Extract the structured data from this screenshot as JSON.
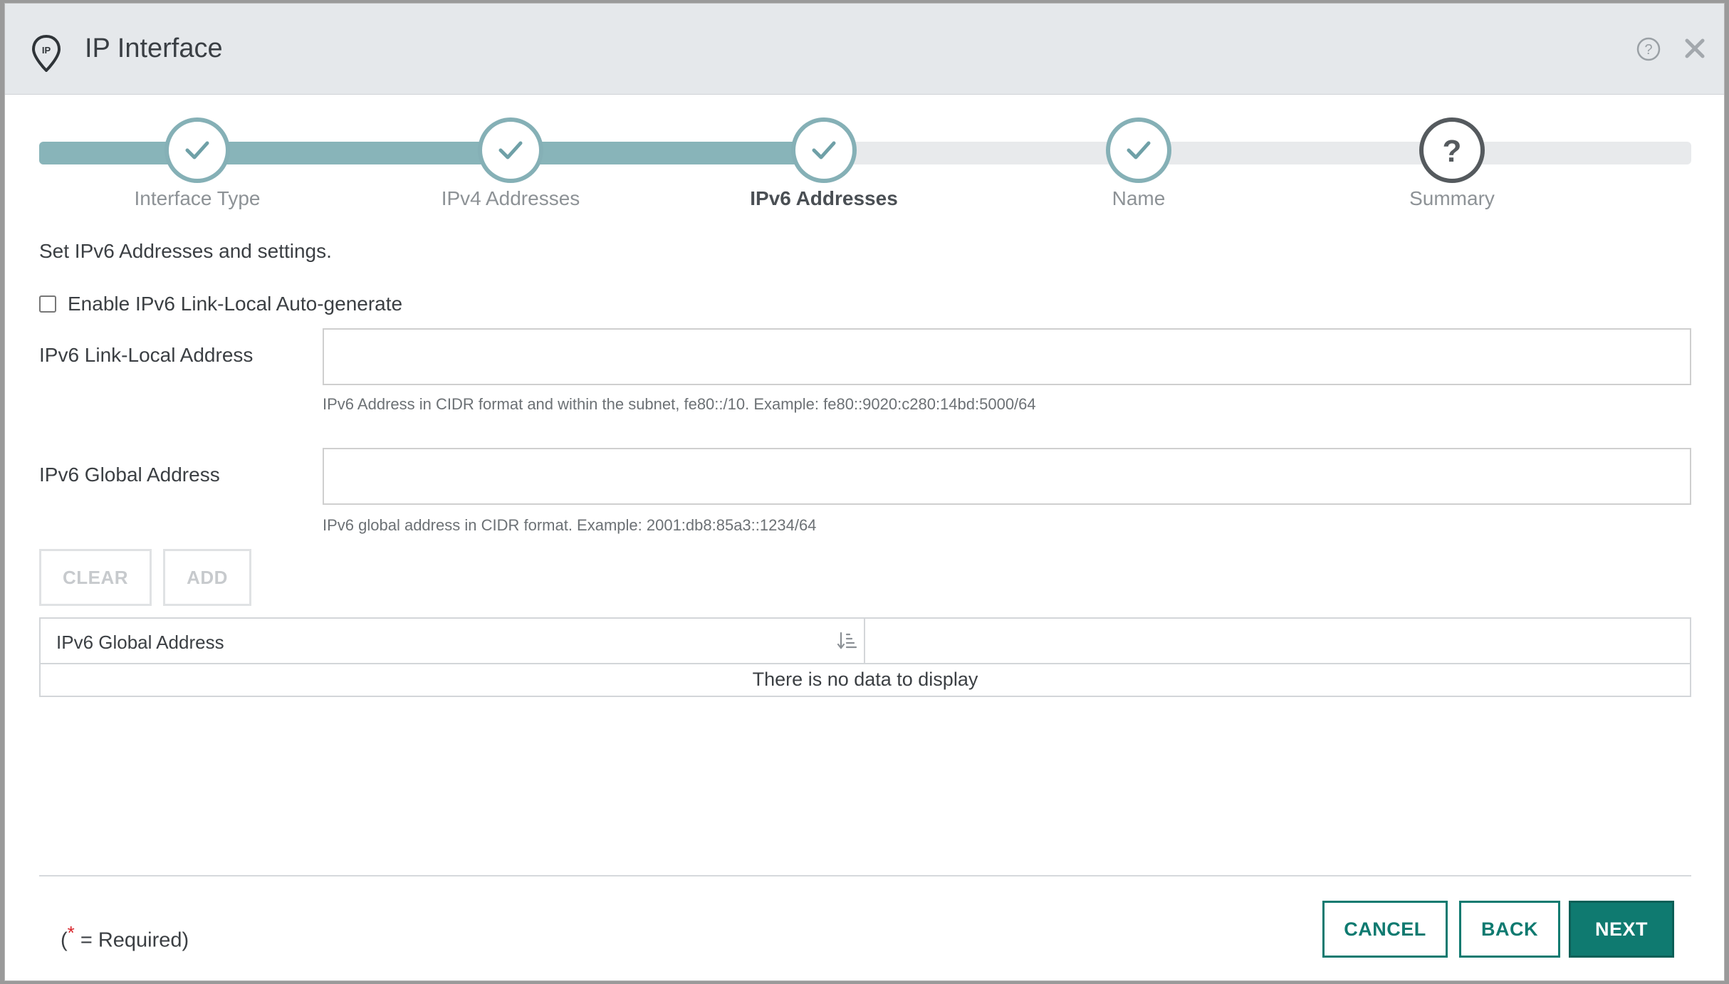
{
  "dialog": {
    "title": "IP Interface",
    "help_icon": "help-circle-icon",
    "close_icon": "close-icon"
  },
  "stepper": {
    "steps": [
      {
        "label": "Interface Type",
        "state": "complete"
      },
      {
        "label": "IPv4 Addresses",
        "state": "complete"
      },
      {
        "label": "IPv6 Addresses",
        "state": "current"
      },
      {
        "label": "Name",
        "state": "complete"
      },
      {
        "label": "Summary",
        "state": "pending"
      }
    ]
  },
  "form": {
    "intro": "Set IPv6 Addresses and settings.",
    "enable_link_local_label": "Enable IPv6 Link-Local Auto-generate",
    "enable_link_local_checked": false,
    "link_local": {
      "label": "IPv6 Link-Local Address",
      "value": "",
      "help": "IPv6 Address in CIDR format and within the subnet, fe80::/10. Example: fe80::9020:c280:14bd:5000/64"
    },
    "global": {
      "label": "IPv6 Global Address",
      "value": "",
      "help": "IPv6 global address in CIDR format. Example: 2001:db8:85a3::1234/64"
    },
    "clear_label": "CLEAR",
    "add_label": "ADD"
  },
  "table": {
    "columns": [
      "IPv6 Global Address",
      ""
    ],
    "empty_message": "There is no data to display",
    "rows": []
  },
  "footer": {
    "required_open": "(",
    "required_star": "*",
    "required_text": " = Required)",
    "cancel_label": "CANCEL",
    "back_label": "BACK",
    "next_label": "NEXT"
  },
  "colors": {
    "accent": "#0f7a70",
    "step_complete": "#85b0b6",
    "header_bg": "#e5e8eb"
  }
}
